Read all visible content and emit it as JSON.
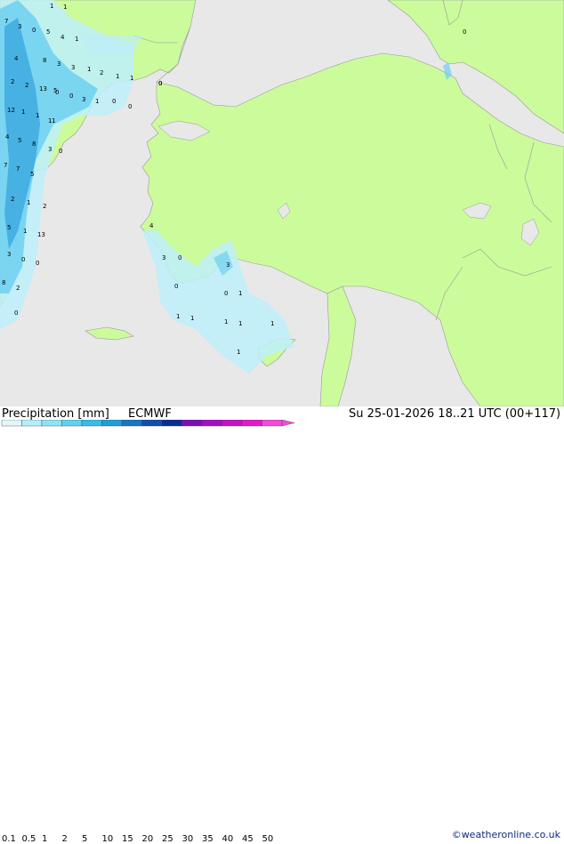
{
  "header": {
    "title": "Precipitation [mm]",
    "model": "ECMWF",
    "valid_time": "Su 25-01-2026 18..21 UTC (00+117)"
  },
  "legend": {
    "ticks": [
      "0.1",
      "0.5",
      "1",
      "2",
      "5",
      "10",
      "15",
      "20",
      "25",
      "30",
      "35",
      "40",
      "45",
      "50"
    ],
    "colors": [
      "#e1f7fb",
      "#b5eef8",
      "#8ce3f4",
      "#5fd2ee",
      "#34bde6",
      "#1f9fd8",
      "#1576c4",
      "#0e4fae",
      "#0a2b95",
      "#7d0fb8",
      "#a30fc5",
      "#c512c9",
      "#e318cc",
      "#f24cd8"
    ]
  },
  "credit": "©weatheronline.co.uk",
  "map": {
    "colors": {
      "sea": "#e8e8e8",
      "land": "#ccfb9c",
      "border": "#999999",
      "rain_light": "#bdeefa",
      "rain_mid": "#6dd0f2",
      "rain_heavy": "#3ba7e0"
    },
    "labels": [
      "1",
      "1",
      "7",
      "3",
      "0",
      "5",
      "4",
      "1",
      "3",
      "1",
      "4",
      "8",
      "3",
      "2",
      "2",
      "1",
      "1",
      "0",
      "0",
      "2",
      "5",
      "13",
      "0",
      "3",
      "1",
      "0",
      "0",
      "12",
      "1",
      "1",
      "1",
      "5",
      "8",
      "3",
      "4",
      "7",
      "5",
      "7",
      "2",
      "1",
      "2",
      "5",
      "1",
      "13",
      "3",
      "0",
      "0",
      "8",
      "2",
      "0",
      "1",
      "4",
      "3",
      "0",
      "3",
      "0",
      "0",
      "1",
      "1",
      "1",
      "1",
      "1",
      "1",
      "1",
      "0",
      "0",
      "0"
    ]
  }
}
